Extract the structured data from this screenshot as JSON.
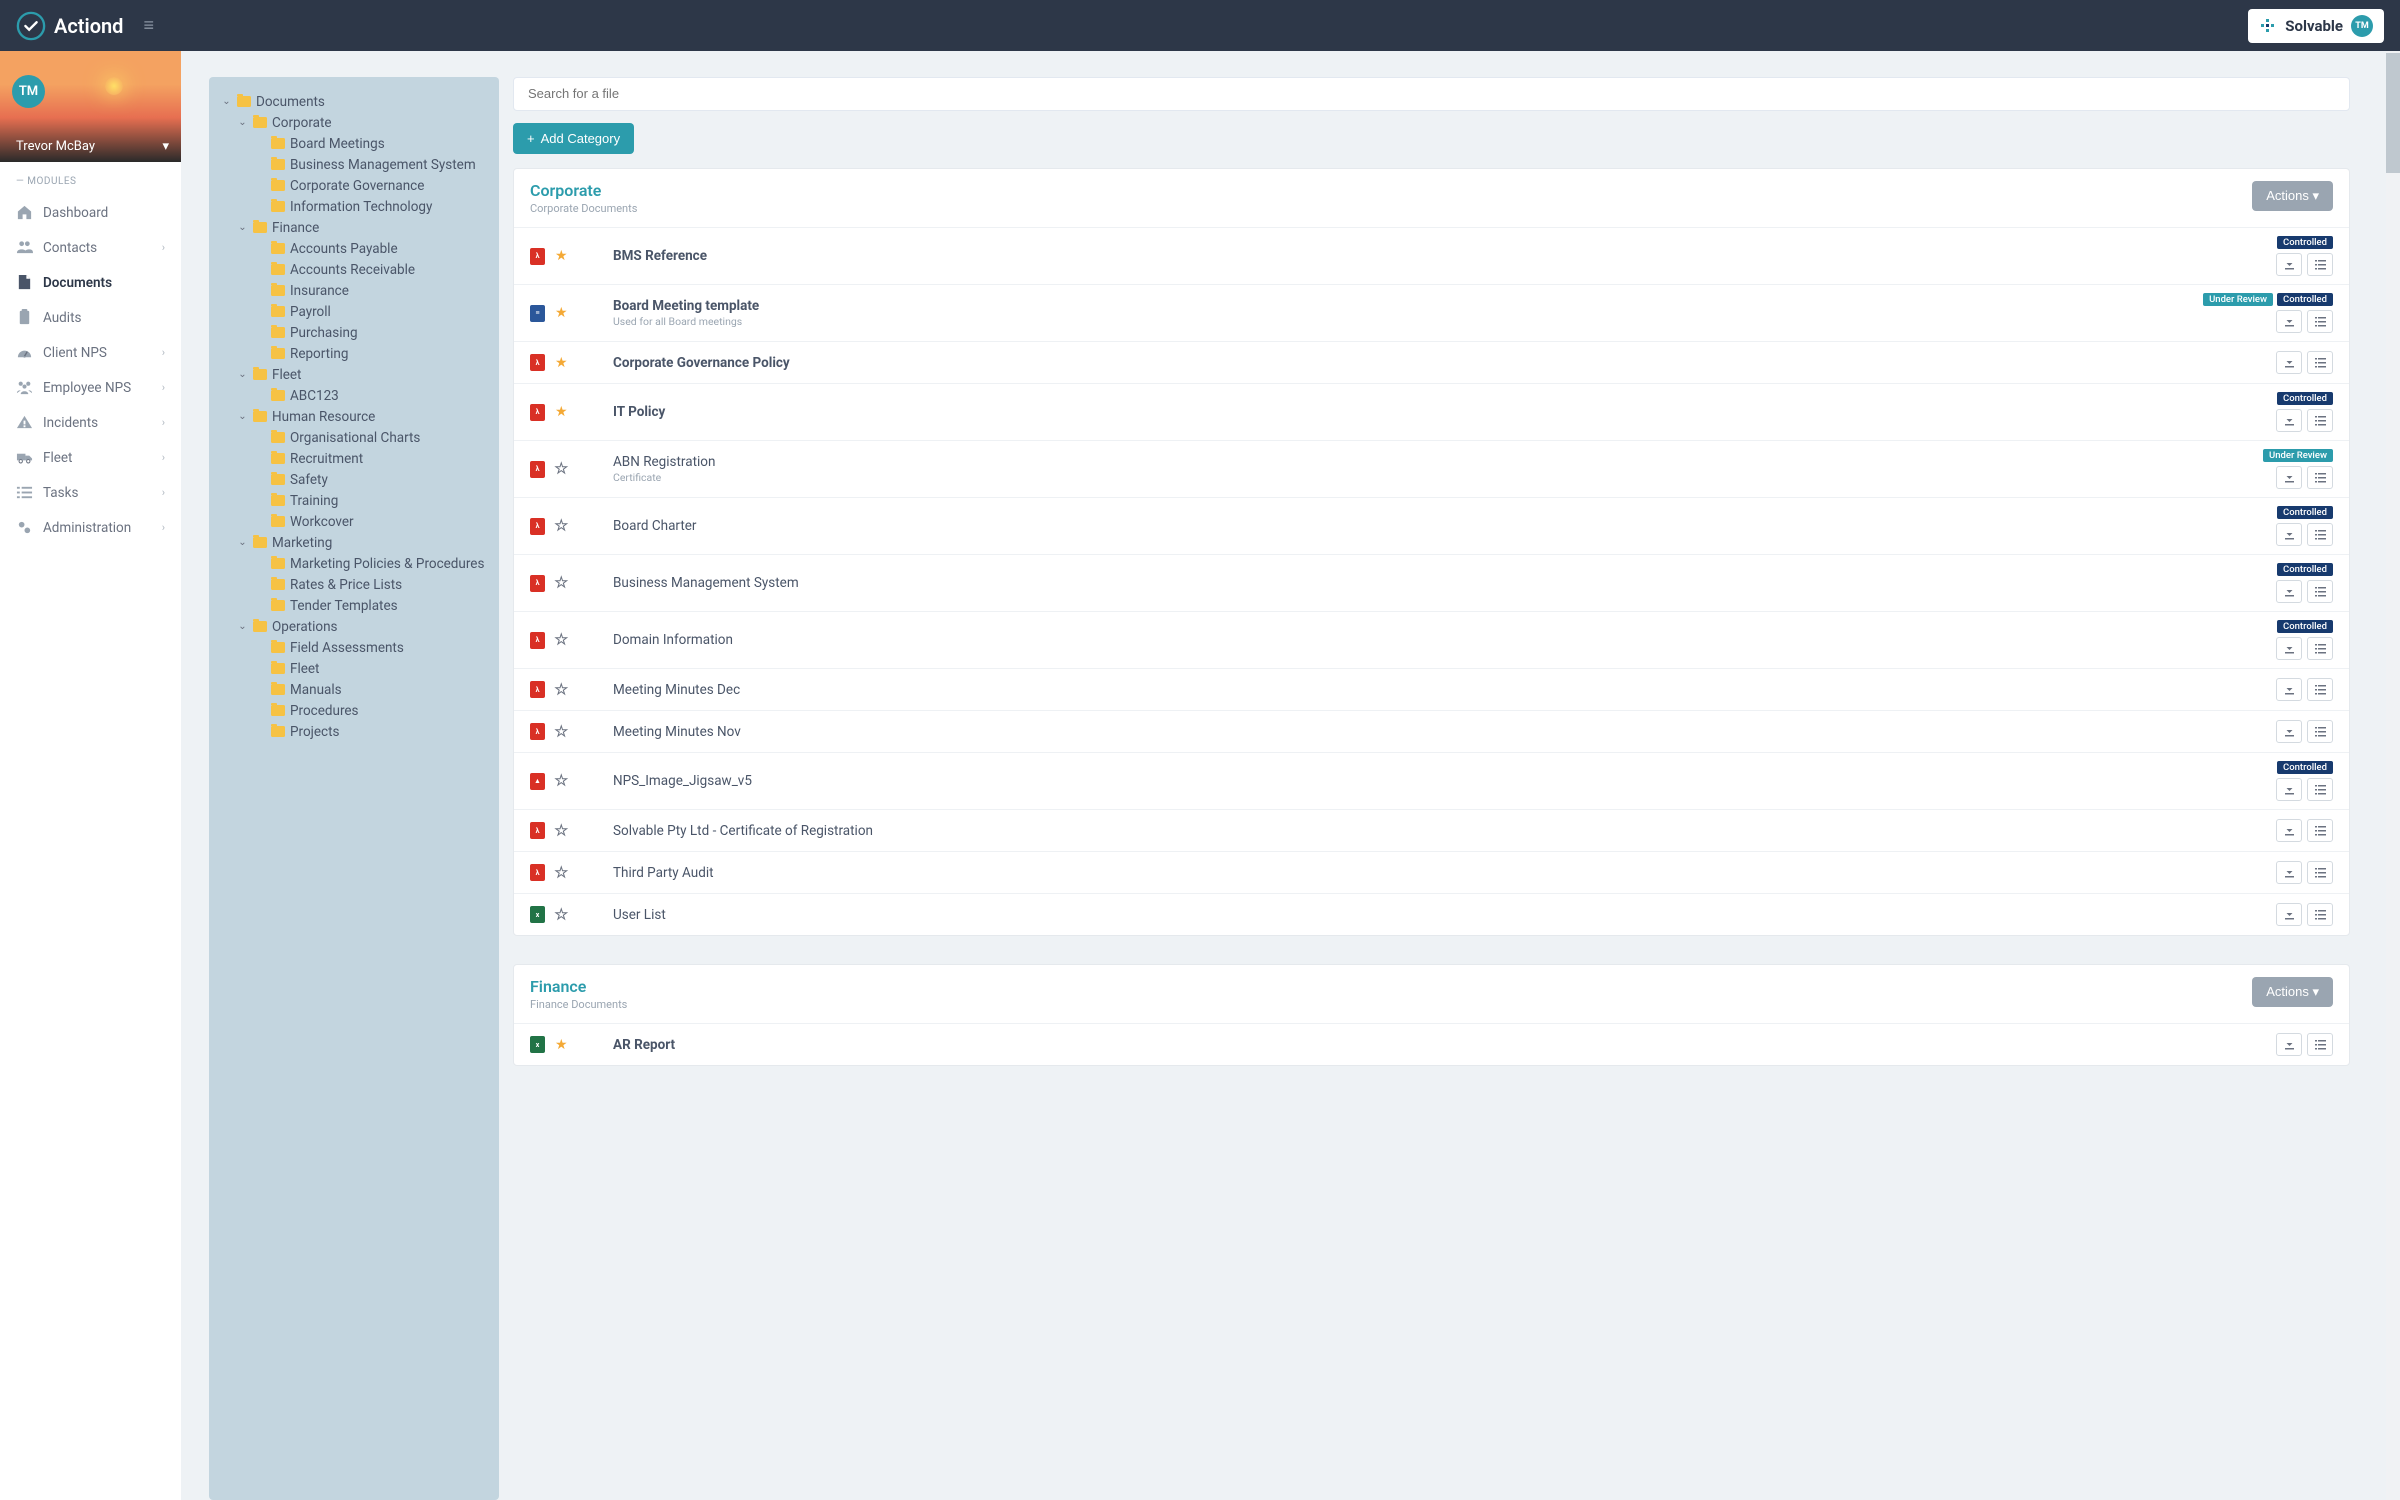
{
  "brand": {
    "name": "Actiond",
    "partner": "Solvable",
    "partner_initials": "TM"
  },
  "user": {
    "initials": "TM",
    "name": "Trevor McBay"
  },
  "sidebar": {
    "section_label": "— MODULES",
    "items": [
      {
        "label": "Dashboard",
        "icon": "home",
        "expandable": false
      },
      {
        "label": "Contacts",
        "icon": "users",
        "expandable": true
      },
      {
        "label": "Documents",
        "icon": "file",
        "expandable": false,
        "active": true
      },
      {
        "label": "Audits",
        "icon": "clipboard",
        "expandable": false
      },
      {
        "label": "Client NPS",
        "icon": "gauge",
        "expandable": true
      },
      {
        "label": "Employee NPS",
        "icon": "people",
        "expandable": true
      },
      {
        "label": "Incidents",
        "icon": "warning",
        "expandable": true
      },
      {
        "label": "Fleet",
        "icon": "truck",
        "expandable": true
      },
      {
        "label": "Tasks",
        "icon": "list",
        "expandable": true
      },
      {
        "label": "Administration",
        "icon": "gears",
        "expandable": true
      }
    ]
  },
  "tree": [
    {
      "label": "Documents",
      "level": 0,
      "caret": true
    },
    {
      "label": "Corporate",
      "level": 1,
      "caret": true
    },
    {
      "label": "Board Meetings",
      "level": 2
    },
    {
      "label": "Business Management System",
      "level": 2
    },
    {
      "label": "Corporate Governance",
      "level": 2
    },
    {
      "label": "Information Technology",
      "level": 2
    },
    {
      "label": "Finance",
      "level": 1,
      "caret": true
    },
    {
      "label": "Accounts Payable",
      "level": 2
    },
    {
      "label": "Accounts Receivable",
      "level": 2
    },
    {
      "label": "Insurance",
      "level": 2
    },
    {
      "label": "Payroll",
      "level": 2
    },
    {
      "label": "Purchasing",
      "level": 2
    },
    {
      "label": "Reporting",
      "level": 2
    },
    {
      "label": "Fleet",
      "level": 1,
      "caret": true
    },
    {
      "label": "ABC123",
      "level": 2
    },
    {
      "label": "Human Resource",
      "level": 1,
      "caret": true
    },
    {
      "label": "Organisational Charts",
      "level": 2
    },
    {
      "label": "Recruitment",
      "level": 2
    },
    {
      "label": "Safety",
      "level": 2
    },
    {
      "label": "Training",
      "level": 2
    },
    {
      "label": "Workcover",
      "level": 2
    },
    {
      "label": "Marketing",
      "level": 1,
      "caret": true
    },
    {
      "label": "Marketing Policies & Procedures",
      "level": 2
    },
    {
      "label": "Rates & Price Lists",
      "level": 2
    },
    {
      "label": "Tender Templates",
      "level": 2
    },
    {
      "label": "Operations",
      "level": 1,
      "caret": true
    },
    {
      "label": "Field Assessments",
      "level": 2
    },
    {
      "label": "Fleet",
      "level": 2
    },
    {
      "label": "Manuals",
      "level": 2
    },
    {
      "label": "Procedures",
      "level": 2
    },
    {
      "label": "Projects",
      "level": 2
    }
  ],
  "search": {
    "placeholder": "Search for a file"
  },
  "buttons": {
    "add_category": "Add Category",
    "actions": "Actions"
  },
  "badges": {
    "controlled": "Controlled",
    "under_review": "Under Review"
  },
  "categories": [
    {
      "title": "Corporate",
      "subtitle": "Corporate Documents",
      "docs": [
        {
          "name": "BMS Reference",
          "ft": "pdf",
          "star": true,
          "bold": true,
          "badges": [
            "controlled"
          ]
        },
        {
          "name": "Board Meeting template",
          "desc": "Used for all Board meetings",
          "ft": "word",
          "star": true,
          "bold": true,
          "badges": [
            "under_review",
            "controlled"
          ]
        },
        {
          "name": "Corporate Governance Policy",
          "ft": "pdf",
          "star": true,
          "bold": true,
          "badges": []
        },
        {
          "name": "IT Policy",
          "ft": "pdf",
          "star": true,
          "bold": true,
          "badges": [
            "controlled"
          ]
        },
        {
          "name": "ABN Registration",
          "desc": "Certificate",
          "ft": "pdf",
          "star": false,
          "badges": [
            "under_review"
          ]
        },
        {
          "name": "Board Charter",
          "ft": "pdf",
          "star": false,
          "badges": [
            "controlled"
          ]
        },
        {
          "name": "Business Management System",
          "ft": "pdf",
          "star": false,
          "badges": [
            "controlled"
          ]
        },
        {
          "name": "Domain Information",
          "ft": "pdf",
          "star": false,
          "badges": [
            "controlled"
          ]
        },
        {
          "name": "Meeting Minutes Dec",
          "ft": "pdf",
          "star": false,
          "badges": []
        },
        {
          "name": "Meeting Minutes Nov",
          "ft": "pdf",
          "star": false,
          "badges": []
        },
        {
          "name": "NPS_Image_Jigsaw_v5",
          "ft": "img",
          "star": false,
          "badges": [
            "controlled"
          ]
        },
        {
          "name": "Solvable Pty Ltd - Certificate of Registration",
          "ft": "pdf",
          "star": false,
          "badges": []
        },
        {
          "name": "Third Party Audit",
          "ft": "pdf",
          "star": false,
          "badges": []
        },
        {
          "name": "User List",
          "ft": "excel",
          "star": false,
          "badges": []
        }
      ]
    },
    {
      "title": "Finance",
      "subtitle": "Finance Documents",
      "docs": [
        {
          "name": "AR Report",
          "ft": "excel",
          "star": true,
          "bold": true,
          "badges": []
        }
      ]
    }
  ]
}
